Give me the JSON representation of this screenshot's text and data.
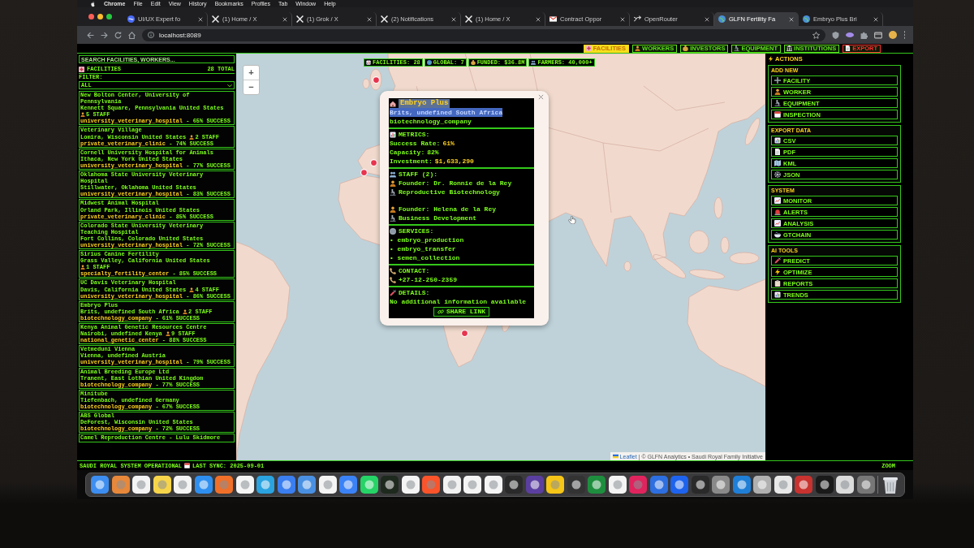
{
  "menu_bar": {
    "app": "Chrome",
    "items": [
      "File",
      "Edit",
      "View",
      "History",
      "Bookmarks",
      "Profiles",
      "Tab",
      "Window",
      "Help"
    ]
  },
  "browser_tabs": [
    {
      "title": "UI/UX Expert fo",
      "selected": false
    },
    {
      "title": "(1) Home / X",
      "selected": false
    },
    {
      "title": "(1) Grok / X",
      "selected": false
    },
    {
      "title": "(2) Notifications",
      "selected": false
    },
    {
      "title": "(1) Home / X",
      "selected": false
    },
    {
      "title": "Contract Oppor",
      "selected": false
    },
    {
      "title": "OpenRouter",
      "selected": false
    },
    {
      "title": "GLFN Fertility Fa",
      "selected": true
    },
    {
      "title": "Embryo Plus Bri",
      "selected": false
    }
  ],
  "address_bar": {
    "url": "localhost:8089"
  },
  "nav_tabs": [
    {
      "label": "FACILITIES",
      "selected": true,
      "color": "#ffd21f"
    },
    {
      "label": "WORKERS",
      "selected": false,
      "color": "#5fe01c"
    },
    {
      "label": "INVESTORS",
      "selected": false,
      "color": "#5fe01c"
    },
    {
      "label": "EQUIPMENT",
      "selected": false,
      "color": "#5fe01c"
    },
    {
      "label": "INSTITUTIONS",
      "selected": false,
      "color": "#5fe01c"
    },
    {
      "label": "EXPORT",
      "selected": false,
      "color": "#ff3030"
    }
  ],
  "sidebar": {
    "search": {
      "placeholder": "SEARCH FACILITIES, WORKERS..."
    },
    "title": "FACILITIES",
    "total": "28 TOTAL",
    "filter_label": "FILTER:",
    "filter_value": "ALL",
    "facilities": [
      {
        "name": "New Bolton Center, University of Pennsylvania",
        "location": "Kennett Square, Pennsylvania United States",
        "staff": "5 STAFF",
        "type": "university_veterinary_hospital",
        "success": "- 65% SUCCESS"
      },
      {
        "name": "Veterinary Village",
        "location": "Lomira, Wisconsin United States",
        "staff": "2 STAFF",
        "type": "private_veterinary_clinic",
        "success": "- 74% SUCCESS"
      },
      {
        "name": "Cornell University Hospital for Animals",
        "location": "Ithaca, New York United States",
        "type": "university_veterinary_hospital",
        "success": "- 77% SUCCESS"
      },
      {
        "name": "Oklahoma State University Veterinary Hospital",
        "location": "Stillwater, Oklahoma United States",
        "type": "university_veterinary_hospital",
        "success": "- 83% SUCCESS"
      },
      {
        "name": "Midwest Animal Hospital",
        "location": "Orland Park, Illinois United States",
        "type": "private_veterinary_clinic",
        "success": "- 85% SUCCESS"
      },
      {
        "name": "Colorado State University Veterinary Teaching Hospital",
        "location": "Fort Collins, Colorado United States",
        "type": "university_veterinary_hospital",
        "success": "- 72% SUCCESS"
      },
      {
        "name": "Sirius Canine Fertility",
        "location": "Grass Valley, California United States",
        "staff": "1 STAFF",
        "type": "specialty_fertility_center",
        "success": "- 85% SUCCESS"
      },
      {
        "name": "UC Davis Veterinary Hospital",
        "location": "Davis, California United States",
        "staff": "4 STAFF",
        "type": "university_veterinary_hospital",
        "success": "- 86% SUCCESS"
      },
      {
        "name": "Embryo Plus",
        "location": "Brits, undefined South Africa",
        "staff": "2 STAFF",
        "type": "biotechnology_company",
        "success": "- 61% SUCCESS"
      },
      {
        "name": "Kenya Animal Genetic Resources Centre",
        "location": "Nairobi, undefined Kenya",
        "staff": "9 STAFF",
        "type": "national_genetic_center",
        "success": "- 88% SUCCESS"
      },
      {
        "name": "Vetmeduni Vienna",
        "location": "Vienna, undefined Austria",
        "type": "university_veterinary_hospital",
        "success": "- 79% SUCCESS"
      },
      {
        "name": "Animal Breeding Europe Ltd",
        "location": "Tranent, East Lothian United Kingdom",
        "type": "biotechnology_company",
        "success": "- 77% SUCCESS"
      },
      {
        "name": "Minitube",
        "location": "Tiefenbach, undefined Germany",
        "type": "biotechnology_company",
        "success": "- 67% SUCCESS"
      },
      {
        "name": "ABS Global",
        "location": "DeForest, Wisconsin United States",
        "type": "biotechnology_company",
        "success": "- 72% SUCCESS"
      },
      {
        "name": "Camel Reproduction Centre - Lulu Skidmore"
      }
    ]
  },
  "map": {
    "zoom_in": "+",
    "zoom_out": "−",
    "stats": [
      "FACILITIES: 28",
      "GLOBAL: 7",
      "FUNDED: $36.8M",
      "FARMERS: 40,000+"
    ],
    "popup": {
      "title": {
        "text": "Embryo Plus",
        "selected": true
      },
      "location": {
        "text": "Brits, undefined South Africa",
        "selected": true
      },
      "type": "biotechnology_company",
      "sections": [
        {
          "kind": "metrics",
          "heading": "METRICS:",
          "rows": [
            {
              "label": "Success Rate:",
              "value": "61%",
              "highlight": true
            },
            {
              "label": "Capacity:",
              "value": "82%",
              "highlight": false
            },
            {
              "label": "Investment:",
              "value": "$1,633,290",
              "highlight": true
            }
          ]
        },
        {
          "kind": "staff",
          "heading": "STAFF (2):",
          "people": [
            {
              "role": "Founder: Dr. Ronnie de la Rey",
              "field": "Reproductive Biotechnology"
            },
            {
              "role": "Founder: Helena de la Rey",
              "field": "Business Development"
            }
          ]
        },
        {
          "kind": "services",
          "heading": "SERVICES:",
          "items": [
            "• embryo_production",
            "• embryo_transfer",
            "• semen_collection"
          ]
        },
        {
          "kind": "contact",
          "heading": "CONTACT:",
          "items": [
            "+27-12-250-2359"
          ]
        },
        {
          "kind": "details",
          "heading": "DETAILS:",
          "items": [
            "No additional information available"
          ]
        }
      ],
      "share": "SHARE LINK"
    },
    "attribution": {
      "link": "Leaflet",
      "text": "| © GLFN Analytics • Saudi Royal Family Initiative"
    }
  },
  "actions": {
    "title": "ACTIONS",
    "groups": [
      {
        "title": "ADD NEW",
        "buttons": [
          "FACILITY",
          "WORKER",
          "EQUIPMENT",
          "INSPECTION"
        ]
      },
      {
        "title": "EXPORT DATA",
        "buttons": [
          "CSV",
          "PDF",
          "KML",
          "JSON"
        ]
      },
      {
        "title": "SYSTEM",
        "buttons": [
          "MONITOR",
          "ALERTS",
          "ANALYSIS",
          "GTCHAIN"
        ]
      },
      {
        "title": "AI TOOLS",
        "buttons": [
          "PREDICT",
          "OPTIMIZE",
          "REPORTS",
          "TRENDS"
        ]
      }
    ]
  },
  "status_bar": {
    "status": "SAUDI ROYAL SYSTEM OPERATIONAL",
    "sync": "LAST SYNC: 2025-09-01",
    "zoom": "ZOOM"
  }
}
